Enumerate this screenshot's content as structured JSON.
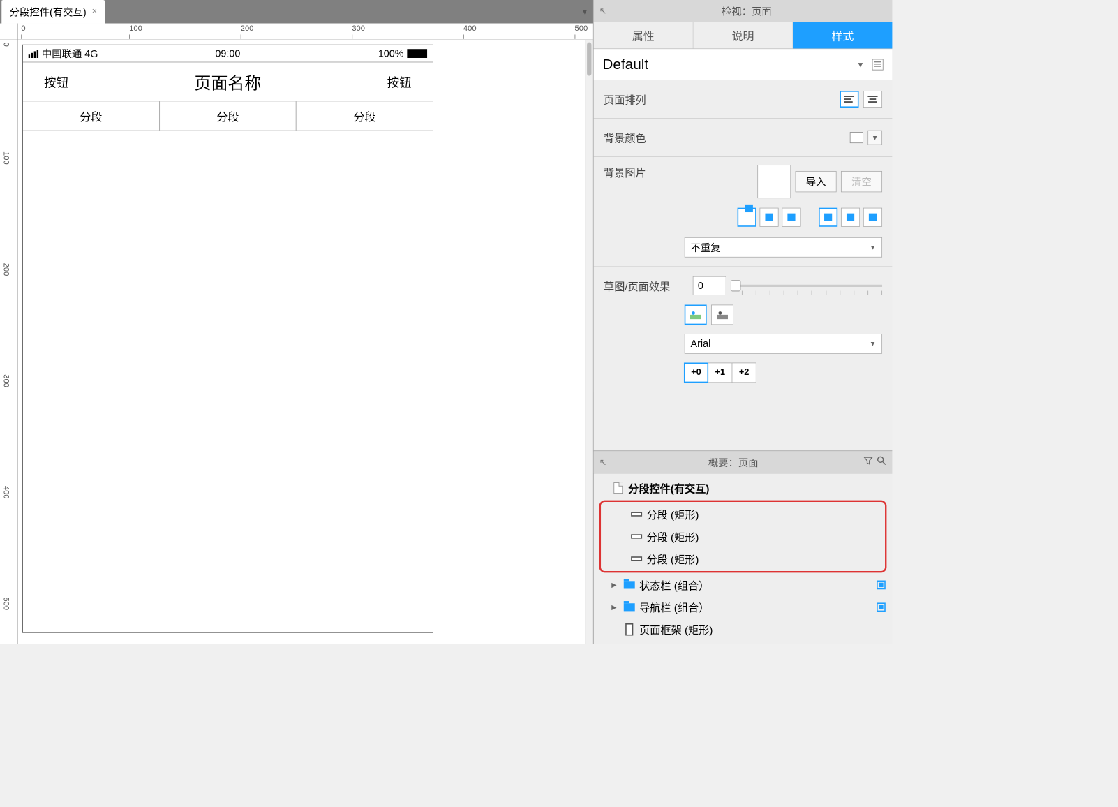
{
  "tab": {
    "title": "分段控件(有交互)"
  },
  "ruler": {
    "h_ticks": [
      "0",
      "100",
      "200",
      "300",
      "400",
      "500"
    ],
    "v_ticks": [
      "0",
      "100",
      "200",
      "300",
      "400",
      "500"
    ]
  },
  "phone": {
    "status": {
      "carrier": "中国联通 4G",
      "time": "09:00",
      "battery_pct": "100%"
    },
    "nav": {
      "left": "按钮",
      "title": "页面名称",
      "right": "按钮"
    },
    "segments": [
      "分段",
      "分段",
      "分段"
    ]
  },
  "inspector": {
    "header": "检视：页面",
    "tabs": {
      "props": "属性",
      "notes": "说明",
      "style": "样式"
    },
    "default_label": "Default",
    "page_align": "页面排列",
    "bg_color": "背景颜色",
    "bg_image": "背景图片",
    "import_btn": "导入",
    "clear_btn": "清空",
    "repeat_select": "不重复",
    "sketch_label": "草图/页面效果",
    "sketch_value": "0",
    "font_select": "Arial",
    "levels": [
      "+0",
      "+1",
      "+2"
    ]
  },
  "outline": {
    "header": "概要：页面",
    "root": "分段控件(有交互)",
    "seg_items": [
      "分段 (矩形)",
      "分段 (矩形)",
      "分段 (矩形)"
    ],
    "statusbar": "状态栏 (组合）",
    "navbar": "导航栏 (组合）",
    "frame": "页面框架 (矩形)"
  }
}
